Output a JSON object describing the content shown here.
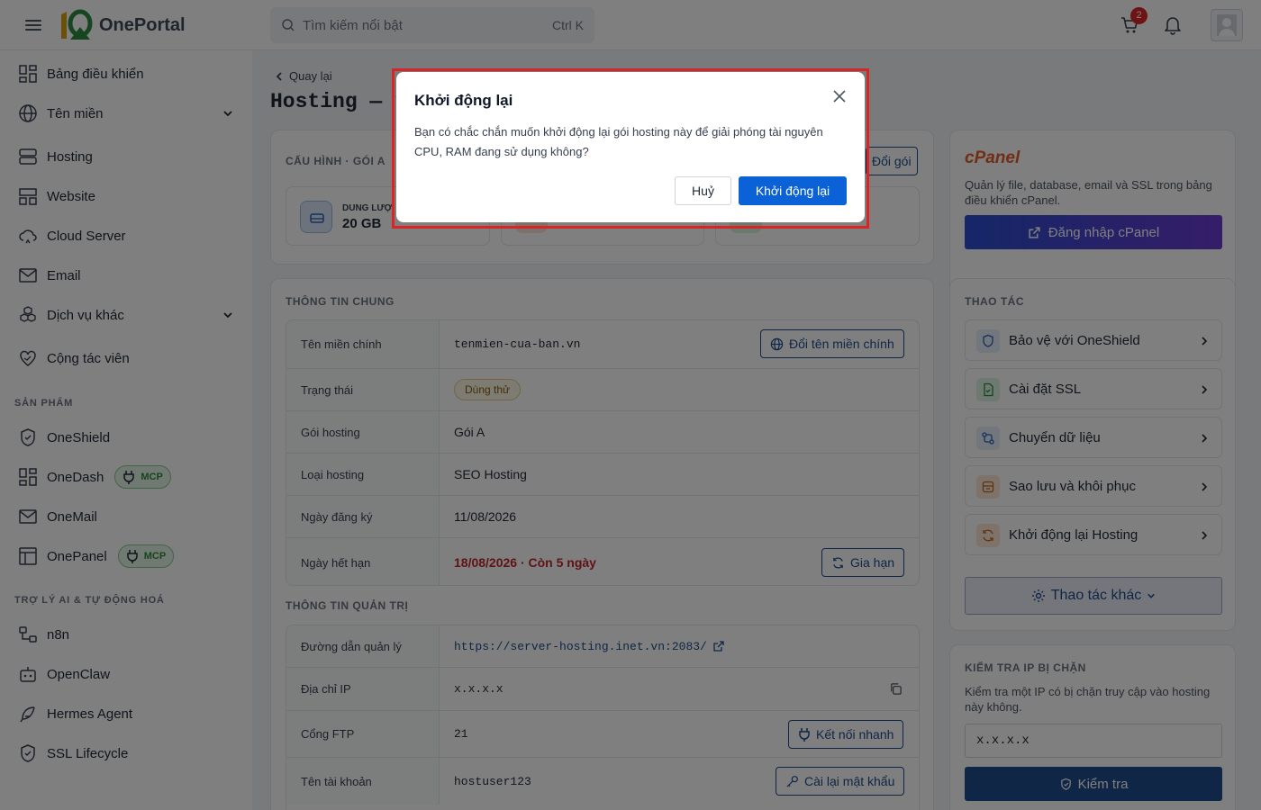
{
  "header": {
    "logo_text": "OnePortal",
    "search_placeholder": "Tìm kiếm nổi bật",
    "search_shortcut": "Ctrl K",
    "cart_count": "2"
  },
  "sidebar": {
    "items": [
      {
        "label": "Bảng điều khiển"
      },
      {
        "label": "Tên miền"
      },
      {
        "label": "Hosting"
      },
      {
        "label": "Website"
      },
      {
        "label": "Cloud Server"
      },
      {
        "label": "Email"
      },
      {
        "label": "Dịch vụ khác"
      },
      {
        "label": "Cộng tác viên"
      }
    ],
    "section_products": "SẢN PHẨM",
    "products": [
      {
        "label": "OneShield"
      },
      {
        "label": "OneDash",
        "badge": "MCP"
      },
      {
        "label": "OneMail"
      },
      {
        "label": "OnePanel",
        "badge": "MCP"
      }
    ],
    "section_ai": "TRỢ LÝ AI & TỰ ĐỘNG HOÁ",
    "ai": [
      {
        "label": "n8n"
      },
      {
        "label": "OpenClaw"
      },
      {
        "label": "Hermes Agent"
      },
      {
        "label": "SSL Lifecycle"
      }
    ]
  },
  "page": {
    "back_label": "Quay lại",
    "title": "Hosting — t"
  },
  "config": {
    "heading": "CẤU HÌNH · GÓI A",
    "change_plan": "Đổi gói",
    "stat_label": "DUNG LƯỢ",
    "stat_value": "20 GB"
  },
  "general": {
    "heading": "THÔNG TIN CHUNG",
    "rows": [
      {
        "key": "Tên miền chính",
        "value": "tenmien-cua-ban.vn",
        "action": "Đổi tên miền chính"
      },
      {
        "key": "Trạng thái",
        "value": "Dùng thử"
      },
      {
        "key": "Gói hosting",
        "value": "Gói A"
      },
      {
        "key": "Loại hosting",
        "value": "SEO Hosting"
      },
      {
        "key": "Ngày đăng ký",
        "value": "11/08/2026"
      },
      {
        "key": "Ngày hết hạn",
        "value": "18/08/2026 · Còn 5 ngày",
        "action": "Gia hạn"
      }
    ]
  },
  "admin": {
    "heading": "THÔNG TIN QUẢN TRỊ",
    "rows": [
      {
        "key": "Đường dẫn quản lý",
        "value": "https://server-hosting.inet.vn:2083/"
      },
      {
        "key": "Địa chỉ IP",
        "value": "x.x.x.x"
      },
      {
        "key": "Cổng FTP",
        "value": "21",
        "action": "Kết nối nhanh"
      },
      {
        "key": "Tên tài khoản",
        "value": "hostuser123",
        "action": "Cài lại mật khẩu"
      }
    ]
  },
  "cpanel": {
    "title": "cPanel",
    "description": "Quản lý file, database, email và SSL trong bảng điều khiển cPanel.",
    "login": "Đăng nhập cPanel"
  },
  "actions": {
    "heading": "THAO TÁC",
    "items": [
      {
        "label": "Bảo vệ với OneShield"
      },
      {
        "label": "Cài đặt SSL"
      },
      {
        "label": "Chuyển dữ liệu"
      },
      {
        "label": "Sao lưu và khôi phục"
      },
      {
        "label": "Khởi động lại Hosting"
      }
    ],
    "more": "Thao tác khác"
  },
  "ipcheck": {
    "heading": "KIỂM TRA IP BỊ CHẶN",
    "description": "Kiểm tra một IP có bị chặn truy cập vào hosting này không.",
    "input_value": "x.x.x.x",
    "button": "Kiểm tra"
  },
  "modal": {
    "title": "Khởi động lại",
    "body": "Bạn có chắc chắn muốn khởi động lại gói hosting này để giải phóng tài nguyên CPU, RAM đang sử dụng không?",
    "cancel": "Huỷ",
    "confirm": "Khởi động lại"
  },
  "colors": {
    "primary": "#1e4d8c",
    "confirm": "#0b62d6",
    "danger": "#c0262d",
    "highlight_border": "#d92525"
  }
}
